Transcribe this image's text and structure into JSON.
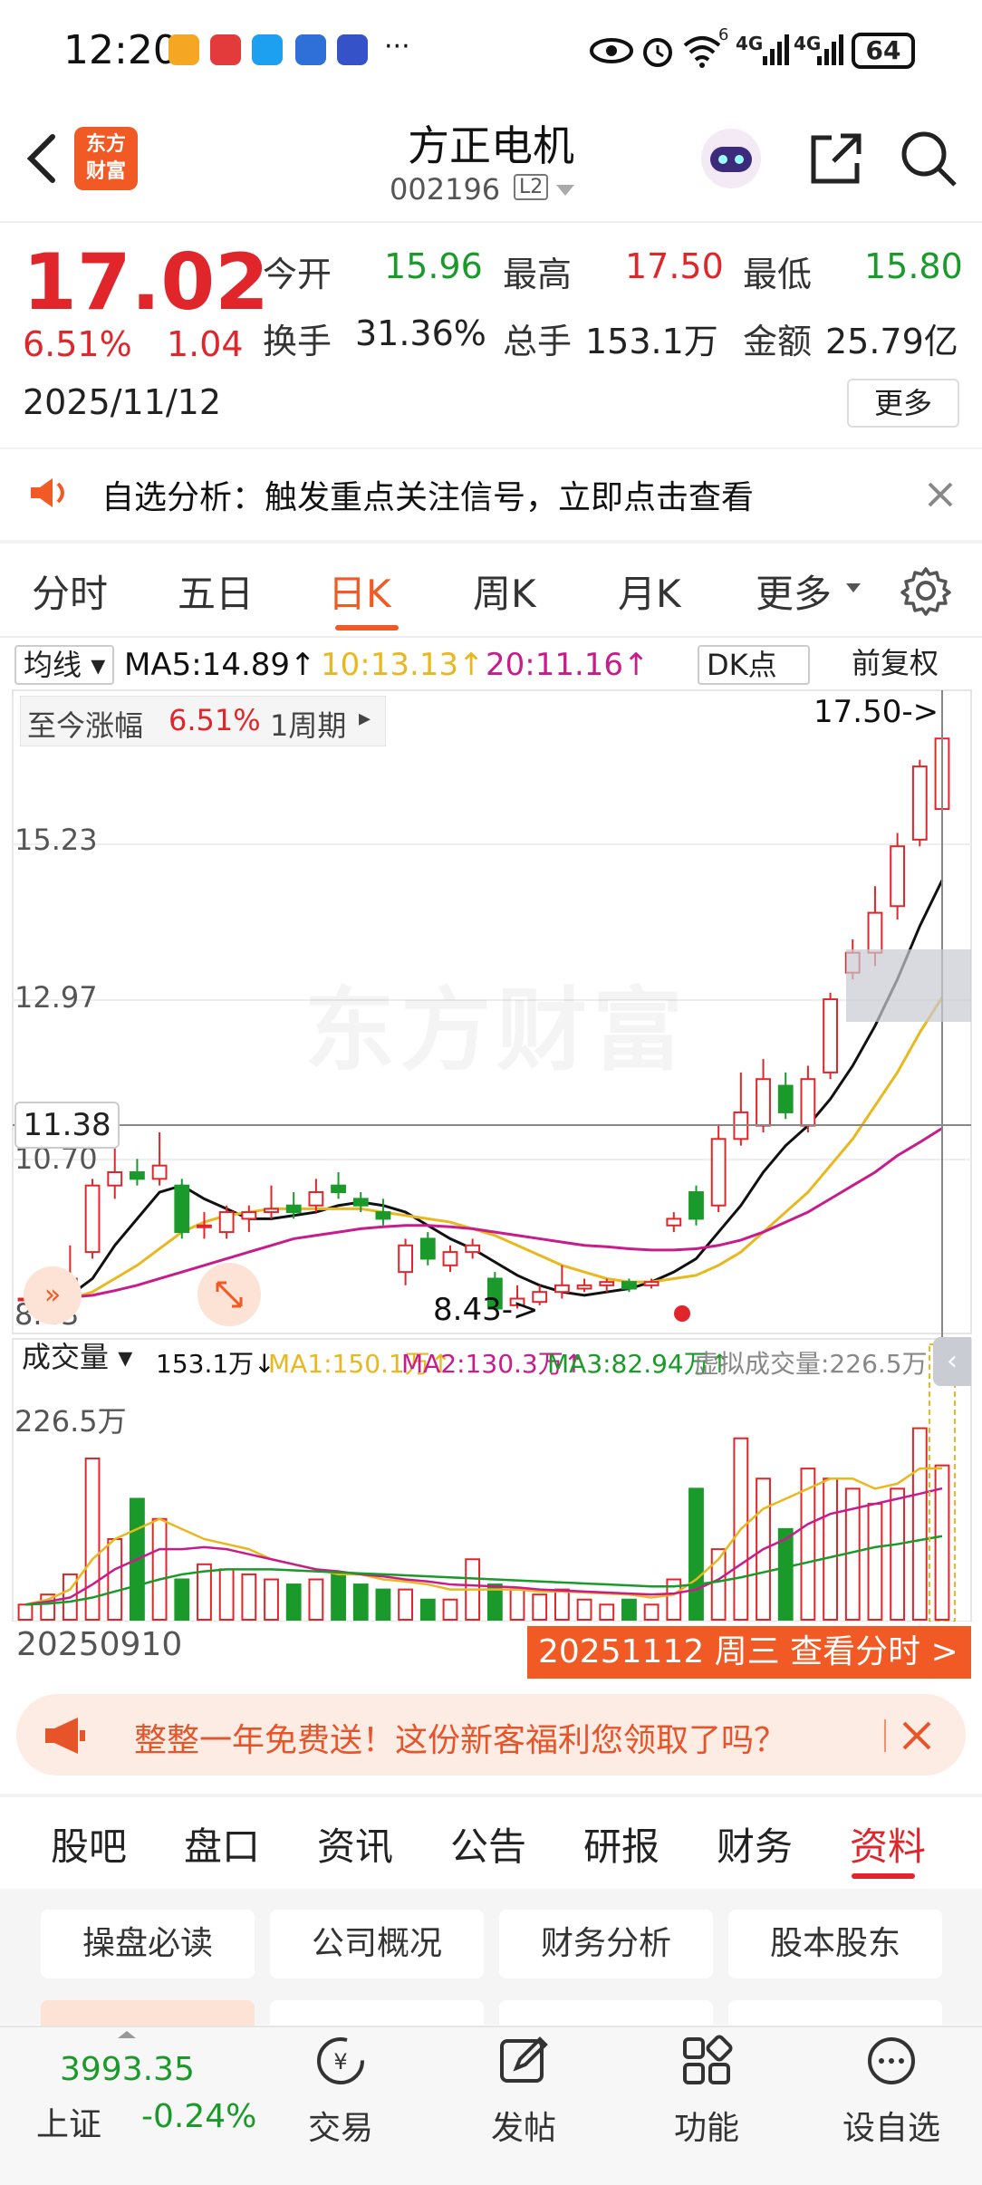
{
  "status_bar": {
    "time": "12:20",
    "more_dots": "···",
    "net1": "4G",
    "net2": "4G",
    "wifi_sup": "6",
    "battery": "64"
  },
  "header": {
    "logo_text_line1": "东方",
    "logo_text_line2": "财富",
    "stock_name": "方正电机",
    "stock_code": "002196",
    "level_badge": "L2"
  },
  "quote": {
    "price": "17.02",
    "change_pct": "6.51%",
    "change_abs": "1.04",
    "date": "2025/11/12",
    "open_label": "今开",
    "open_value": "15.96",
    "high_label": "最高",
    "high_value": "17.50",
    "low_label": "最低",
    "low_value": "15.80",
    "turnover_label": "换手",
    "turnover_value": "31.36%",
    "volume_label": "总手",
    "volume_value": "153.1万",
    "amount_label": "金额",
    "amount_value": "25.79亿",
    "more_label": "更多"
  },
  "notice": {
    "text": "自选分析：触发重点关注信号，立即点击查看"
  },
  "period_tabs": [
    "分时",
    "五日",
    "日K",
    "周K",
    "月K",
    "更多"
  ],
  "active_period": "日K",
  "ma_legend": {
    "selector": "均线",
    "ma5": "MA5:14.89↑",
    "ma10": "10:13.13↑",
    "ma20": "20:11.16↑",
    "dk_button": "DK点",
    "adjust_button": "前复权"
  },
  "range_info": {
    "label": "至今涨幅",
    "pct": "6.51%",
    "period": "1周期"
  },
  "chart_labels": {
    "y1": "15.23",
    "y2": "12.97",
    "y3": "10.70",
    "y4": "8.43",
    "crosshair_price": "11.38",
    "high_marker": "17.50->",
    "low_marker": "8.43->",
    "watermark": "东方财富"
  },
  "volume_legend": {
    "selector": "成交量",
    "vol": "153.1万↓",
    "ma1": "MA1:150.1万↑",
    "ma2": "MA2:130.3万↑",
    "ma3": "MA3:82.94万↑",
    "virtual": "虚拟成交量:226.5万",
    "max_label": "226.5万"
  },
  "date_bar": {
    "start": "20250910",
    "end": "20251112 周三 查看分时 >"
  },
  "promo": {
    "text": "整整一年免费送！这份新客福利您领取了吗？"
  },
  "bottom_tabs": [
    "股吧",
    "盘口",
    "资讯",
    "公告",
    "研报",
    "财务",
    "资料"
  ],
  "active_bottom_tab": "资料",
  "profile_buttons": [
    "操盘必读",
    "公司概况",
    "财务分析",
    "股本股东"
  ],
  "bottom_nav": {
    "index_value": "3993.35",
    "index_name": "上证",
    "index_change": "-0.24%",
    "trade": "交易",
    "post": "发帖",
    "functions": "功能",
    "watchlist": "设自选"
  },
  "chart_data": {
    "type": "candlestick",
    "ylim": [
      8.43,
      17.5
    ],
    "x_start": "20250910",
    "x_end": "20251112",
    "candles": [
      {
        "o": 8.6,
        "c": 8.6,
        "h": 8.7,
        "l": 8.5
      },
      {
        "o": 8.55,
        "c": 8.75,
        "h": 8.9,
        "l": 8.5
      },
      {
        "o": 8.7,
        "c": 8.9,
        "h": 9.4,
        "l": 8.6
      },
      {
        "o": 9.3,
        "c": 10.3,
        "h": 10.4,
        "l": 9.2
      },
      {
        "o": 10.3,
        "c": 10.5,
        "h": 10.9,
        "l": 10.1
      },
      {
        "o": 10.5,
        "c": 10.4,
        "h": 10.7,
        "l": 10.3
      },
      {
        "o": 10.4,
        "c": 10.6,
        "h": 11.1,
        "l": 10.3
      },
      {
        "o": 10.3,
        "c": 9.6,
        "h": 10.4,
        "l": 9.5
      },
      {
        "o": 9.7,
        "c": 9.7,
        "h": 9.9,
        "l": 9.5
      },
      {
        "o": 9.6,
        "c": 9.9,
        "h": 10.0,
        "l": 9.5
      },
      {
        "o": 9.8,
        "c": 9.9,
        "h": 10.0,
        "l": 9.6
      },
      {
        "o": 9.9,
        "c": 9.95,
        "h": 10.3,
        "l": 9.8
      },
      {
        "o": 10.0,
        "c": 9.9,
        "h": 10.2,
        "l": 9.8
      },
      {
        "o": 10.0,
        "c": 10.2,
        "h": 10.4,
        "l": 9.9
      },
      {
        "o": 10.3,
        "c": 10.2,
        "h": 10.5,
        "l": 10.1
      },
      {
        "o": 10.1,
        "c": 10.0,
        "h": 10.2,
        "l": 9.9
      },
      {
        "o": 9.9,
        "c": 9.8,
        "h": 10.1,
        "l": 9.7
      },
      {
        "o": 9.0,
        "c": 9.4,
        "h": 9.5,
        "l": 8.8
      },
      {
        "o": 9.5,
        "c": 9.2,
        "h": 9.6,
        "l": 9.1
      },
      {
        "o": 9.1,
        "c": 9.3,
        "h": 9.4,
        "l": 9.0
      },
      {
        "o": 9.3,
        "c": 9.4,
        "h": 9.5,
        "l": 9.2
      },
      {
        "o": 8.9,
        "c": 8.45,
        "h": 9.0,
        "l": 8.43
      },
      {
        "o": 8.5,
        "c": 8.6,
        "h": 8.8,
        "l": 8.45
      },
      {
        "o": 8.55,
        "c": 8.7,
        "h": 8.8,
        "l": 8.5
      },
      {
        "o": 8.7,
        "c": 8.8,
        "h": 9.1,
        "l": 8.6
      },
      {
        "o": 8.75,
        "c": 8.8,
        "h": 8.9,
        "l": 8.7
      },
      {
        "o": 8.8,
        "c": 8.85,
        "h": 8.9,
        "l": 8.7
      },
      {
        "o": 8.85,
        "c": 8.75,
        "h": 8.9,
        "l": 8.7
      },
      {
        "o": 8.8,
        "c": 8.85,
        "h": 8.9,
        "l": 8.75
      },
      {
        "o": 9.7,
        "c": 9.8,
        "h": 9.9,
        "l": 9.6
      },
      {
        "o": 10.2,
        "c": 9.8,
        "h": 10.3,
        "l": 9.7
      },
      {
        "o": 10.0,
        "c": 11.0,
        "h": 11.2,
        "l": 9.9
      },
      {
        "o": 11.0,
        "c": 11.4,
        "h": 12.0,
        "l": 10.9
      },
      {
        "o": 11.2,
        "c": 11.9,
        "h": 12.2,
        "l": 11.1
      },
      {
        "o": 11.8,
        "c": 11.4,
        "h": 12.0,
        "l": 11.3
      },
      {
        "o": 11.2,
        "c": 11.9,
        "h": 12.1,
        "l": 11.1
      },
      {
        "o": 12.0,
        "c": 13.1,
        "h": 13.2,
        "l": 11.9
      },
      {
        "o": 13.5,
        "c": 13.8,
        "h": 14.0,
        "l": 13.4
      },
      {
        "o": 13.8,
        "c": 14.4,
        "h": 14.8,
        "l": 13.6
      },
      {
        "o": 14.5,
        "c": 15.4,
        "h": 15.6,
        "l": 14.3
      },
      {
        "o": 15.5,
        "c": 16.6,
        "h": 16.7,
        "l": 15.4
      },
      {
        "o": 15.96,
        "c": 17.02,
        "h": 17.5,
        "l": 15.8
      }
    ],
    "ma5": [
      8.6,
      8.6,
      8.65,
      8.9,
      9.4,
      9.8,
      10.2,
      10.3,
      10.1,
      9.95,
      9.8,
      9.8,
      9.85,
      9.9,
      10.0,
      10.05,
      10.0,
      9.9,
      9.7,
      9.5,
      9.35,
      9.15,
      8.95,
      8.8,
      8.7,
      8.65,
      8.7,
      8.75,
      8.85,
      9.0,
      9.2,
      9.6,
      10.0,
      10.5,
      10.9,
      11.2,
      11.6,
      12.1,
      12.7,
      13.4,
      14.2,
      14.89
    ],
    "ma10": [
      8.6,
      8.6,
      8.6,
      8.7,
      8.9,
      9.1,
      9.35,
      9.6,
      9.75,
      9.85,
      9.9,
      9.95,
      9.95,
      9.95,
      9.95,
      9.95,
      9.9,
      9.85,
      9.8,
      9.75,
      9.65,
      9.55,
      9.4,
      9.25,
      9.1,
      9.0,
      8.9,
      8.85,
      8.85,
      8.9,
      8.95,
      9.1,
      9.3,
      9.6,
      9.9,
      10.2,
      10.6,
      11.0,
      11.5,
      12.0,
      12.6,
      13.13
    ],
    "ma20": [
      8.6,
      8.6,
      8.62,
      8.65,
      8.72,
      8.8,
      8.9,
      9.0,
      9.1,
      9.2,
      9.3,
      9.4,
      9.5,
      9.55,
      9.6,
      9.65,
      9.68,
      9.7,
      9.7,
      9.68,
      9.65,
      9.6,
      9.55,
      9.5,
      9.45,
      9.4,
      9.38,
      9.35,
      9.33,
      9.33,
      9.35,
      9.4,
      9.48,
      9.6,
      9.75,
      9.9,
      10.1,
      10.3,
      10.5,
      10.75,
      10.95,
      11.16
    ],
    "volume_ylim": [
      0,
      226.5
    ],
    "volumes": [
      15,
      25,
      45,
      160,
      80,
      120,
      100,
      40,
      55,
      50,
      45,
      40,
      35,
      40,
      45,
      35,
      30,
      30,
      20,
      20,
      60,
      35,
      30,
      25,
      30,
      20,
      15,
      20,
      15,
      40,
      130,
      70,
      180,
      140,
      90,
      150,
      140,
      130,
      115,
      130,
      190,
      153.1
    ],
    "vol_ma1": [
      15,
      20,
      30,
      60,
      80,
      90,
      100,
      90,
      80,
      75,
      70,
      60,
      55,
      50,
      45,
      45,
      40,
      38,
      35,
      30,
      30,
      30,
      30,
      28,
      28,
      27,
      26,
      25,
      22,
      25,
      40,
      60,
      90,
      110,
      120,
      130,
      140,
      140,
      130,
      135,
      150,
      150.1
    ],
    "vol_ma2": [
      15,
      18,
      22,
      35,
      50,
      60,
      70,
      70,
      72,
      70,
      65,
      60,
      55,
      50,
      48,
      45,
      43,
      40,
      38,
      35,
      34,
      33,
      32,
      30,
      29,
      28,
      27,
      26,
      25,
      26,
      30,
      40,
      55,
      70,
      80,
      95,
      105,
      110,
      115,
      120,
      125,
      130.3
    ],
    "vol_ma3": [
      15,
      16,
      18,
      22,
      28,
      34,
      40,
      45,
      48,
      50,
      50,
      50,
      49,
      48,
      47,
      46,
      45,
      44,
      43,
      42,
      41,
      40,
      39,
      38,
      37,
      36,
      35,
      34,
      33,
      33,
      35,
      38,
      42,
      47,
      52,
      57,
      62,
      67,
      72,
      75,
      79,
      82.94
    ]
  }
}
